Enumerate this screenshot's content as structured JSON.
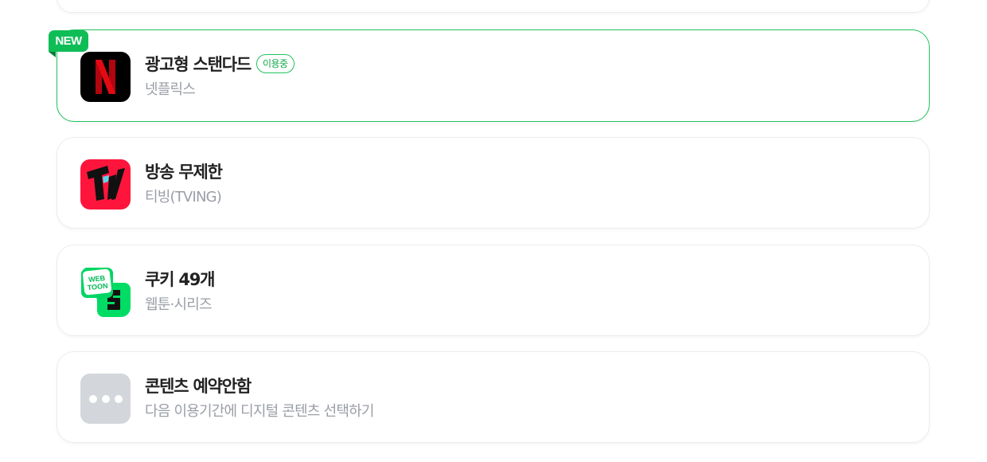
{
  "new_tag": "NEW",
  "services": [
    {
      "title": "광고형 스탠다드",
      "badge": "이용중",
      "subtitle": "넷플릭스",
      "icon": "netflix-logo-icon",
      "icon_letter": "N",
      "selected": true
    },
    {
      "title": "방송 무제한",
      "subtitle": "티빙(TVING)",
      "icon": "tving-logo-icon",
      "selected": false
    },
    {
      "title": "쿠키 49개",
      "subtitle": "웹툰·시리즈",
      "icon": "webtoon-series-logo-icon",
      "icon_text_1": "WEB",
      "icon_text_2": "TOON",
      "selected": false
    },
    {
      "title": "콘텐츠 예약안함",
      "subtitle": "다음 이용기간에 디지털 콘텐츠 선택하기",
      "icon": "more-dots-icon",
      "selected": false
    }
  ],
  "colors": {
    "accent_green": "#21c25c",
    "new_tag_bg": "#0fbd57",
    "netflix_red": "#e50914",
    "tving_red": "#ff153c",
    "webtoon_green": "#00dc64",
    "muted_gray": "#9a9ea6"
  }
}
